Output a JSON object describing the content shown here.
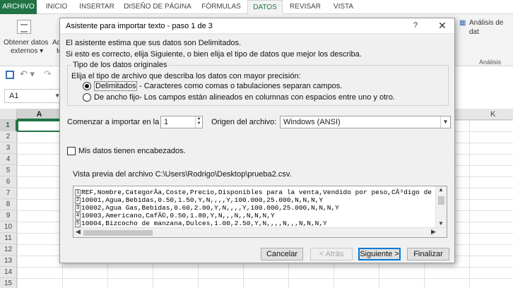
{
  "ribbon_tabs": [
    "ARCHIVO",
    "INICIO",
    "INSERTAR",
    "DISEÑO DE PÁGINA",
    "FÓRMULAS",
    "DATOS",
    "REVISAR",
    "VISTA"
  ],
  "active_tab": "DATOS",
  "ribbon": {
    "get_data_line1": "Obtener datos",
    "get_data_line2": "externos",
    "clipped_1": "Act",
    "clipped_2": "to",
    "whatif": "Análisis de dat",
    "group_analysis": "Análisis"
  },
  "namebox": "A1",
  "grid": {
    "col_a": "A",
    "col_k": "K",
    "rows": [
      "1",
      "2",
      "3",
      "4",
      "5",
      "6",
      "7",
      "8",
      "9",
      "10",
      "11",
      "12",
      "13",
      "14",
      "15"
    ]
  },
  "dialog": {
    "title": "Asistente para importar texto - paso 1 de 3",
    "help": "?",
    "close": "✕",
    "intro1": "El asistente estima que sus datos son Delimitados.",
    "intro2": "Si esto es correcto, elija Siguiente, o bien elija el tipo de datos que mejor los describa.",
    "group_title": "Tipo de los datos originales",
    "group_prompt": "Elija el tipo de archivo que describa los datos con mayor precisión:",
    "opt1_label": "Delimitados",
    "opt1_desc": "- Caracteres como comas o tabulaciones separan campos.",
    "opt2_label": "De ancho fijo",
    "opt2_desc": "- Los campos están alineados en columnas con espacios entre uno y otro.",
    "start_row_label": "Comenzar a importar en la fila:",
    "start_row_value": "1",
    "origin_label": "Origen del archivo:",
    "origin_value": "Windows (ANSI)",
    "headers_label": "Mis datos tienen encabezados.",
    "preview_label": "Vista previa del archivo C:\\Users\\Rodrigo\\Desktop\\prueba2.csv.",
    "preview_lines": [
      {
        "n": "1",
        "text": "REF,Nombre,CategorÃ­a,Coste,Precio,Disponibles para la venta,Vendido por peso,CÃ³digo de"
      },
      {
        "n": "2",
        "text": "10001,Agua,Bebidas,0.50,1.50,Y,N,,,,Y,100.000,25.000,N,N,N,Y"
      },
      {
        "n": "3",
        "text": "10002,Agua Gas,Bebidas,0.60,2.00,Y,N,,,,Y,100.000,25.000,N,N,N,Y"
      },
      {
        "n": "4",
        "text": "10003,Americano,CafÃ©,0.50,1.80,Y,N,,,N,,N,N,N,Y"
      },
      {
        "n": "5",
        "text": "10004,Bizcocho de manzana,Dulces,1.00,2.50,Y,N,,,,N,,,N,N,N,Y"
      }
    ],
    "buttons": {
      "cancel": "Cancelar",
      "back": "< Atrás",
      "next": "Siguiente >",
      "finish": "Finalizar"
    }
  },
  "colors": {
    "excel_green": "#217346",
    "accent_blue": "#0078d7"
  }
}
